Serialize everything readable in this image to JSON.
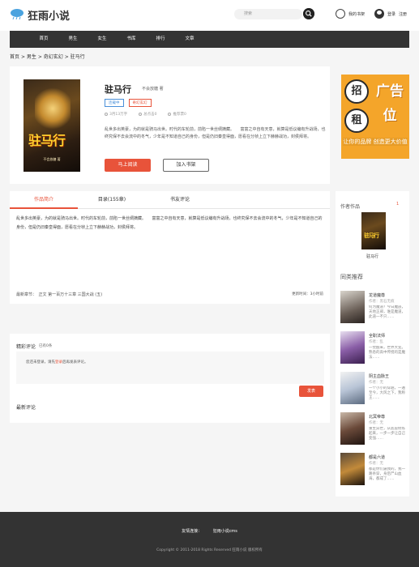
{
  "header": {
    "logo_text": "狂雨小说",
    "search_placeholder": "搜索",
    "shelf_label": "我的书架",
    "login_label": "登录",
    "register_label": "注册"
  },
  "nav": {
    "items": [
      "首页",
      "男生",
      "女生",
      "书库",
      "排行",
      "文章"
    ]
  },
  "breadcrumb": {
    "home": "首页",
    "section": "男生",
    "category": "奇幻玄幻",
    "book": "驻马行",
    "separator": ">"
  },
  "book": {
    "title": "驻马行",
    "author": "不会放糖 著",
    "cover_title": "驻马行",
    "cover_author": "不会放糖 著",
    "tags": [
      "连载中",
      "奇幻玄幻"
    ],
    "stats": [
      "3月13万字",
      "总点击0",
      "推荐票0"
    ],
    "intro_short": "乱世多出英豪，为的就是骑马出世。时代的车轮前，前陷一世丝绸摘藏。　　富富之中自有天意，就算是低议编有升战场，也终究保不去会流中的冬气，少年是不知道自己的身份，但是仍旧秦皇得面，愿看在分桢上立下赫赫战功，封侯拜将。",
    "btn_read": "马上阅读",
    "btn_shelf": "加入书架"
  },
  "ad": {
    "char1": "招",
    "char2": "租",
    "big_text": "广告位",
    "slogan": "让你的品牌 创造更大价值",
    "accent": "#f4a52a"
  },
  "tabs": {
    "items": [
      "作品简介",
      "目录(155章)",
      "书友评论"
    ],
    "active_index": 0,
    "intro_full": "乱世多出英豪，为的就是骑马出世。时代的车轮前，前陷一世丝绸摘藏。　　富富之中自有天意，就算是低议编有升战场，也终究保不去会流中的冬气，少年是不知道自己的身份，但是仍旧秦皇得面，愿看在分桢上立下赫赫战功，封侯拜将。"
  },
  "chapter": {
    "latest_label": "最新章节：　正文 第一百万十三章 三国大战 (五)",
    "update_label": "更新时间：3小时前"
  },
  "comments": {
    "title": "精彩评论",
    "count": "已有0条",
    "hint_prefix": "您还未登录，请先",
    "login_link": "登录",
    "hint_suffix": "后再发表评论。",
    "post_button": "发表",
    "latest_title": "最新评论"
  },
  "sidebar": {
    "author_works_title": "作者作品",
    "author_works_count": "1",
    "author_book_name": "驻马行",
    "recs_title": "同类推荐",
    "recs": [
      {
        "title": "龙道魔尊",
        "author": "作者：黑石无痕",
        "desc": "何为魔道？今日魔族，天地正邪，谁是魔道，此道一不只……"
      },
      {
        "title": "全职法师",
        "author": "作者：乱",
        "desc": "一觉醒来，世界大变。熟悉的高中传授的是魔法……"
      },
      {
        "title": "阴主血脉王",
        "author": "作者：无",
        "desc": "一个小小的穿越，一遍至今，大风之下，我称王……"
      },
      {
        "title": "北冥帝尊",
        "author": "作者：无",
        "desc": "重生异世，从底层修炼起来，一步一步让自己变强……"
      },
      {
        "title": "都是六道",
        "author": "作者：无",
        "desc": "都是你们逼我的，我一路杀穿，身后尸山血海，都成了……"
      }
    ]
  },
  "footer": {
    "links_label": "友情连接：",
    "link1": "狂雨小说cms",
    "copyright": "Copyright © 2011-2018 Rights Reserved 狂雨小说 版权所有"
  },
  "colors": {
    "accent": "#e8533a",
    "nav_bg": "#333333",
    "footer_bg": "#333333"
  },
  "icons": {
    "logo": "cloud-icon",
    "search": "search-icon",
    "shelf": "bookshelf-icon",
    "user": "user-icon"
  }
}
